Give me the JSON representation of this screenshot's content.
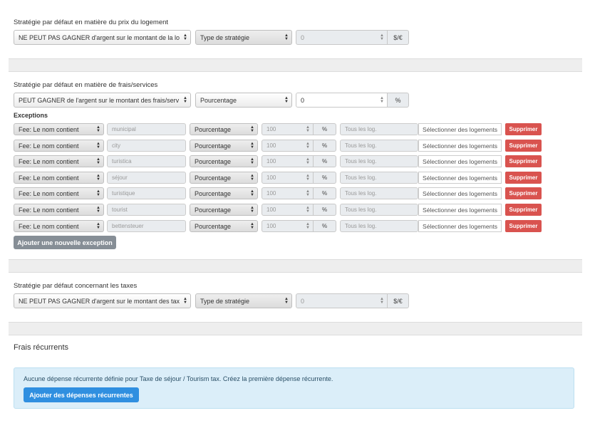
{
  "housing": {
    "title": "Stratégie par défaut en matière du prix du logement",
    "select": "NE PEUT PAS GAGNER d'argent sur le montant de la lo",
    "type": "Type de stratégie",
    "value": "0",
    "unit": "$/€"
  },
  "fees": {
    "title": "Stratégie par défaut en matière de frais/services",
    "select": "PEUT GAGNER de l'argent sur le montant des frais/serv",
    "type": "Pourcentage",
    "value": "0",
    "unit": "%",
    "exceptions_label": "Exceptions",
    "rows": [
      {
        "rule": "Fee: Le nom contient",
        "text": "municipal",
        "type": "Pourcentage",
        "value": "100",
        "unit": "%",
        "scope": "Tous les log.",
        "select_btn": "Sélectionner des logements",
        "delete_btn": "Supprimer"
      },
      {
        "rule": "Fee: Le nom contient",
        "text": "city",
        "type": "Pourcentage",
        "value": "100",
        "unit": "%",
        "scope": "Tous les log.",
        "select_btn": "Sélectionner des logements",
        "delete_btn": "Supprimer"
      },
      {
        "rule": "Fee: Le nom contient",
        "text": "turistica",
        "type": "Pourcentage",
        "value": "100",
        "unit": "%",
        "scope": "Tous les log.",
        "select_btn": "Sélectionner des logements",
        "delete_btn": "Supprimer"
      },
      {
        "rule": "Fee: Le nom contient",
        "text": "séjour",
        "type": "Pourcentage",
        "value": "100",
        "unit": "%",
        "scope": "Tous les log.",
        "select_btn": "Sélectionner des logements",
        "delete_btn": "Supprimer"
      },
      {
        "rule": "Fee: Le nom contient",
        "text": "turistique",
        "type": "Pourcentage",
        "value": "100",
        "unit": "%",
        "scope": "Tous les log.",
        "select_btn": "Sélectionner des logements",
        "delete_btn": "Supprimer"
      },
      {
        "rule": "Fee: Le nom contient",
        "text": "tourist",
        "type": "Pourcentage",
        "value": "100",
        "unit": "%",
        "scope": "Tous les log.",
        "select_btn": "Sélectionner des logements",
        "delete_btn": "Supprimer"
      },
      {
        "rule": "Fee: Le nom contient",
        "text": "bettensteuer",
        "type": "Pourcentage",
        "value": "100",
        "unit": "%",
        "scope": "Tous les log.",
        "select_btn": "Sélectionner des logements",
        "delete_btn": "Supprimer"
      }
    ],
    "add_exception": "Ajouter une nouvelle exception"
  },
  "taxes": {
    "title": "Stratégie par défaut concernant les taxes",
    "select": "NE PEUT PAS GAGNER d'argent sur le montant des tax",
    "type": "Type de stratégie",
    "value": "0",
    "unit": "$/€"
  },
  "recurring": {
    "title": "Frais récurrents",
    "message": "Aucune dépense récurrente définie pour Taxe de séjour / Tourism tax. Créez la première dépense récurrente.",
    "add_button": "Ajouter des dépenses récurrentes"
  },
  "colors": {
    "danger": "#d9534f",
    "primary": "#2f8fe0",
    "secondary": "#868e96",
    "info_bg": "#dbeef9"
  }
}
